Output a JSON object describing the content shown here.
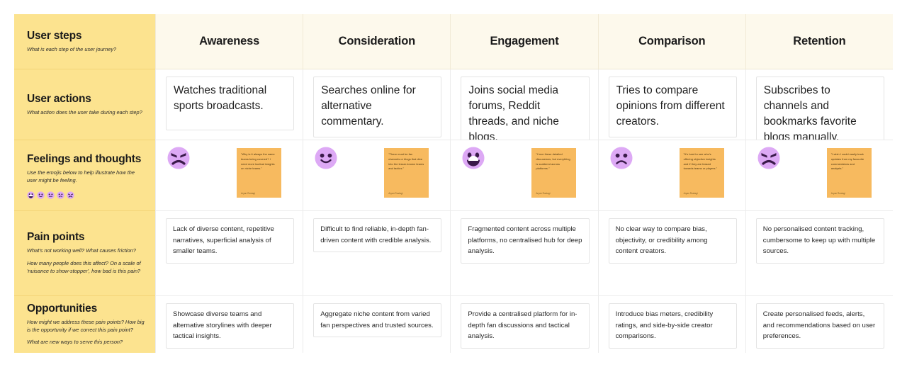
{
  "row_labels": [
    {
      "title": "User steps",
      "hints": [
        "What is each step of the user journey?"
      ]
    },
    {
      "title": "User actions",
      "hints": [
        "What action does the user take during each step?"
      ]
    },
    {
      "title": "Feelings and thoughts",
      "hints": [
        "Use the emojis below to help illustrate how the user might be feeling."
      ],
      "emoji_palette": [
        "grin-emoji",
        "smile-emoji",
        "neutral-emoji",
        "frown-emoji",
        "angry-emoji"
      ]
    },
    {
      "title": "Pain points",
      "hints": [
        "What's not working well? What causes friction?",
        "How many people does this affect? On a scale of 'nuisance to show-stopper', how bad is this pain?"
      ]
    },
    {
      "title": "Opportunities",
      "hints": [
        "How might we address these pain points? How big is the opportunity if we correct this pain point?",
        "What are new ways to serve this person?"
      ]
    }
  ],
  "stages": [
    "Awareness",
    "Consideration",
    "Engagement",
    "Comparison",
    "Retention"
  ],
  "user_actions": [
    "Watches traditional sports broadcasts.",
    "Searches online for alternative commentary.",
    "Joins social media forums, Reddit threads, and niche blogs.",
    "Tries to compare opinions from different creators.",
    "Subscribes to channels and bookmarks favorite blogs manually."
  ],
  "feelings": [
    {
      "emoji": "angry-emoji",
      "quote": "\"Why is it always the same teams being covered? I need more tactical insights on niche teams.\"",
      "attribution": "Aryan Rustagi"
    },
    {
      "emoji": "smile-emoji",
      "quote": "\"There must be fan channels or blogs that dive into the lesser-known teams and tactics.\"",
      "attribution": "Aryan Rustagi"
    },
    {
      "emoji": "grin-emoji",
      "quote": "\"I love these detailed discussions, but everything is scattered across platforms.\"",
      "attribution": "Aryan Rustagi"
    },
    {
      "emoji": "frown-emoji",
      "quote": "\"It's hard to see who's offering objective insights and if they are biased towards teams or players.\"",
      "attribution": "Aryan Rustagi"
    },
    {
      "emoji": "angry-emoji",
      "quote": "\"I wish I could easily track updates from my favourite commentators and analysts.\"",
      "attribution": "Aryan Rustagi"
    }
  ],
  "pain_points": [
    "Lack of diverse content, repetitive narratives, superficial analysis of smaller teams.",
    "Difficult to find reliable, in-depth fan-driven content with credible analysis.",
    "Fragmented content across multiple platforms, no centralised hub for deep analysis.",
    "No clear way to compare bias, objectivity, or credibility among content creators.",
    "No personalised content tracking, cumbersome to keep up with multiple sources."
  ],
  "opportunities": [
    "Showcase diverse teams and alternative storylines with deeper tactical insights.",
    "Aggregate niche content from varied fan perspectives and trusted sources.",
    "Provide a centralised platform for in-depth fan discussions and tactical analysis.",
    "Introduce bias meters, credibility ratings, and side-by-side creator comparisons.",
    "Create personalised feeds, alerts, and recommendations based on user preferences."
  ],
  "colors": {
    "label_column": "#fce38f",
    "header_row": "#fdf9ec",
    "sticky_note": "#f7ba5f",
    "emoji_face": "#dda9f5"
  }
}
